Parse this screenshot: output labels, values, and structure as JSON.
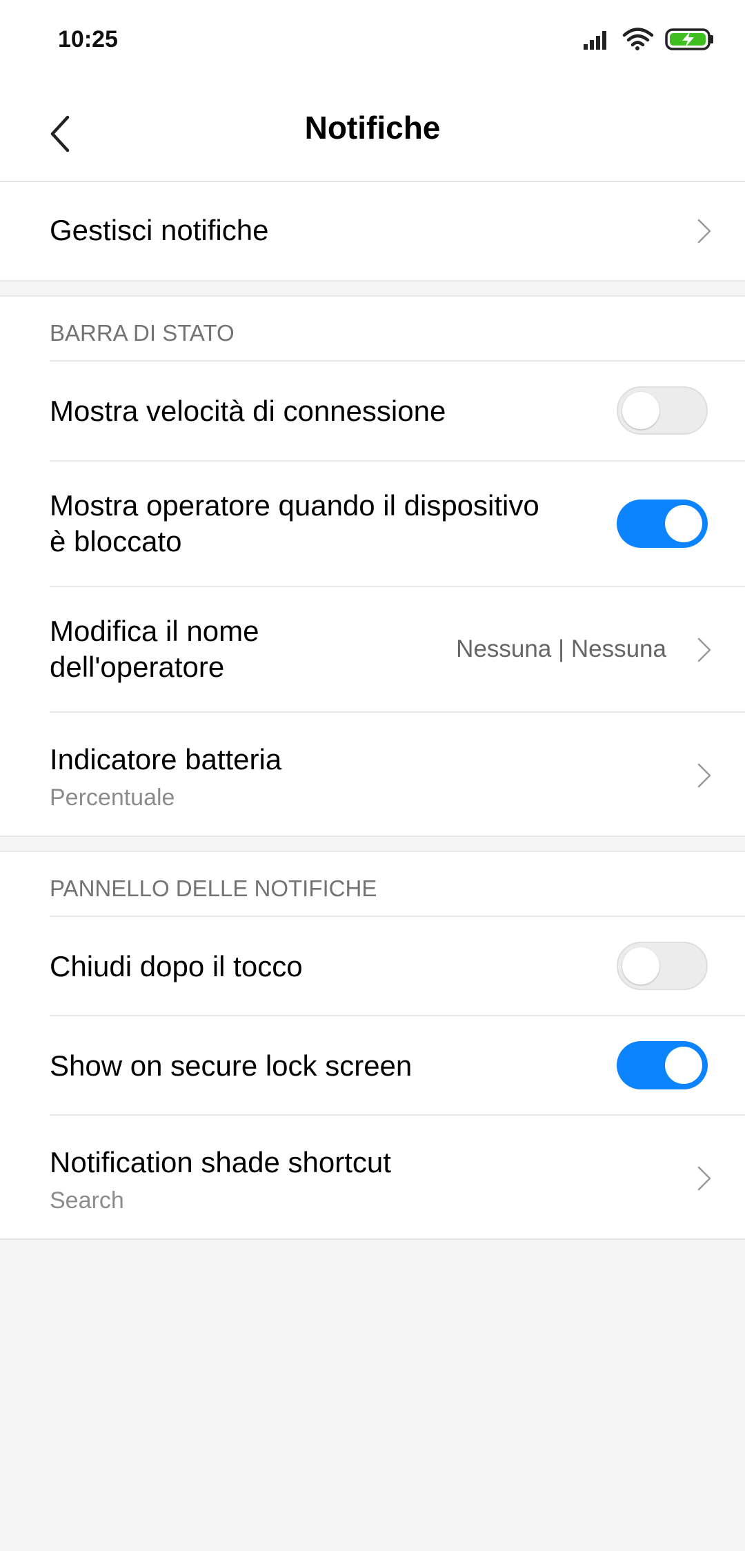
{
  "status_bar": {
    "time": "10:25",
    "icons": [
      "signal-icon",
      "wifi-icon",
      "battery-charging-icon"
    ]
  },
  "header": {
    "back_icon": "chevron-left-icon",
    "title": "Notifiche"
  },
  "sections": {
    "manage": {
      "label": "Gestisci notifiche"
    },
    "status_bar": {
      "title": "BARRA DI STATO",
      "connection_speed": {
        "label": "Mostra velocità di connessione",
        "enabled": false
      },
      "carrier_locked": {
        "label_line1": "Mostra operatore quando il dispositivo",
        "label_line2": "è bloccato",
        "enabled": true
      },
      "carrier_name": {
        "label_line1": "Modifica il nome",
        "label_line2": "dell'operatore",
        "value": "Nessuna | Nessuna"
      },
      "battery": {
        "label": "Indicatore batteria",
        "sub": "Percentuale"
      }
    },
    "notification_panel": {
      "title": "PANNELLO DELLE NOTIFICHE",
      "close_after_tap": {
        "label": "Chiudi dopo il tocco",
        "enabled": false
      },
      "secure_lock": {
        "label": "Show on secure lock screen",
        "enabled": true
      },
      "shade_shortcut": {
        "label": "Notification shade shortcut",
        "sub": "Search"
      }
    }
  },
  "colors": {
    "accent": "#0d84ff",
    "background": "#f5f5f5",
    "battery": "#3fbf1f"
  }
}
